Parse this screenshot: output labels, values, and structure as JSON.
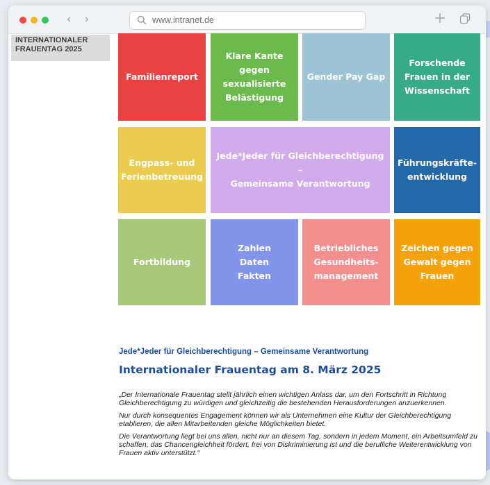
{
  "browser": {
    "url": "www.intranet.de",
    "back_icon": "chevron-left-icon",
    "forward_icon": "chevron-right-icon",
    "new_tab_icon": "plus-icon",
    "tabs_icon": "tabs-overview-icon",
    "traffic_lights": [
      "#ee4c48",
      "#f4b824",
      "#35c759"
    ]
  },
  "sidebar": {
    "items": [
      {
        "label": "INTERNATIONALER\nFRAUENTAG 2025"
      }
    ]
  },
  "tiles": [
    {
      "label": "Familienreport",
      "color": "#e84242"
    },
    {
      "label": "Klare Kante\ngegen sexualisierte\nBelästigung",
      "color": "#6cb94e"
    },
    {
      "label": "Gender Pay Gap",
      "color": "#9dc3d4"
    },
    {
      "label": "Forschende\nFrauen in der\nWissenschaft",
      "color": "#37ab88"
    },
    {
      "label": "Engpass- und\nFerienbetreuung",
      "color": "#ebcc4e"
    },
    {
      "label": "Jede*Jeder für Gleichberechtigung –\nGemeinsame Verantwortung",
      "color": "#d1abeb"
    },
    {
      "label": "Führungskräfte-\nentwicklung",
      "color": "#2468a8"
    },
    {
      "label": "Fortbildung",
      "color": "#a8c97a"
    },
    {
      "label": "Zahlen\nDaten\nFakten",
      "color": "#8295eb"
    },
    {
      "label": "Betriebliches\nGesundheits-\nmanagement",
      "color": "#f38f8f"
    },
    {
      "label": "Zeichen gegen\nGewalt gegen\nFrauen",
      "color": "#f5a30d"
    }
  ],
  "article": {
    "kicker": "Jede*Jeder für Gleichberechtigung – Gemeinsame Verantwortung",
    "headline": "Internationaler Frauentag am 8. März 2025",
    "paragraphs": [
      "„Der Internationale Frauentag stellt jährlich einen wichtigen Anlass dar, um den Fortschritt in Richtung Gleichberechtigung zu würdigen und gleichzeitig die bestehenden Herausforderungen anzuerkennen.",
      "Nur durch konsequentes Engagement können wir als Unternehmen eine Kultur der Gleichberechtigung etablieren, die allen Mitarbeitenden gleiche Möglichkeiten bietet.",
      "Die Verantwortung liegt bei uns allen, nicht nur an diesem Tag, sondern in jedem Moment, ein Arbeitsumfeld zu schaffen, das Chancengleichheit fördert, frei von Diskriminierung ist und die berufliche Weiterentwicklung von Frauen aktiv unterstützt.“"
    ]
  },
  "theme": {
    "heading_color": "#1f4d94",
    "sidebar_bg": "#dcdcdc"
  }
}
